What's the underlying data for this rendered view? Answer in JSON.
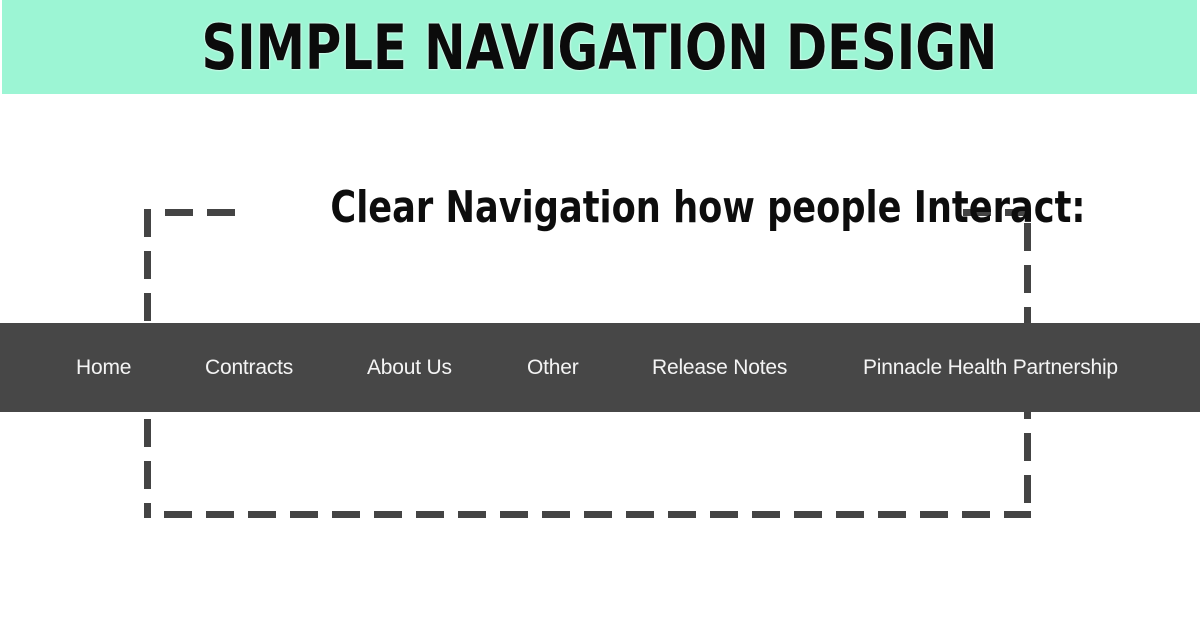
{
  "banner": {
    "title": "SIMPLE NAVIGATION DESIGN"
  },
  "section": {
    "heading": "Clear Navigation how people Interact:"
  },
  "navigation": {
    "items": [
      {
        "label": "Home"
      },
      {
        "label": "Contracts"
      },
      {
        "label": "About Us"
      },
      {
        "label": "Other"
      },
      {
        "label": "Release Notes"
      },
      {
        "label": "Pinnacle Health Partnership"
      }
    ]
  },
  "colors": {
    "banner_background": "#9cf5d4",
    "navbar_background": "#474747",
    "frame_dash": "#444444",
    "nav_text": "#f4f4f4",
    "heading_text": "#0d0d0d"
  }
}
